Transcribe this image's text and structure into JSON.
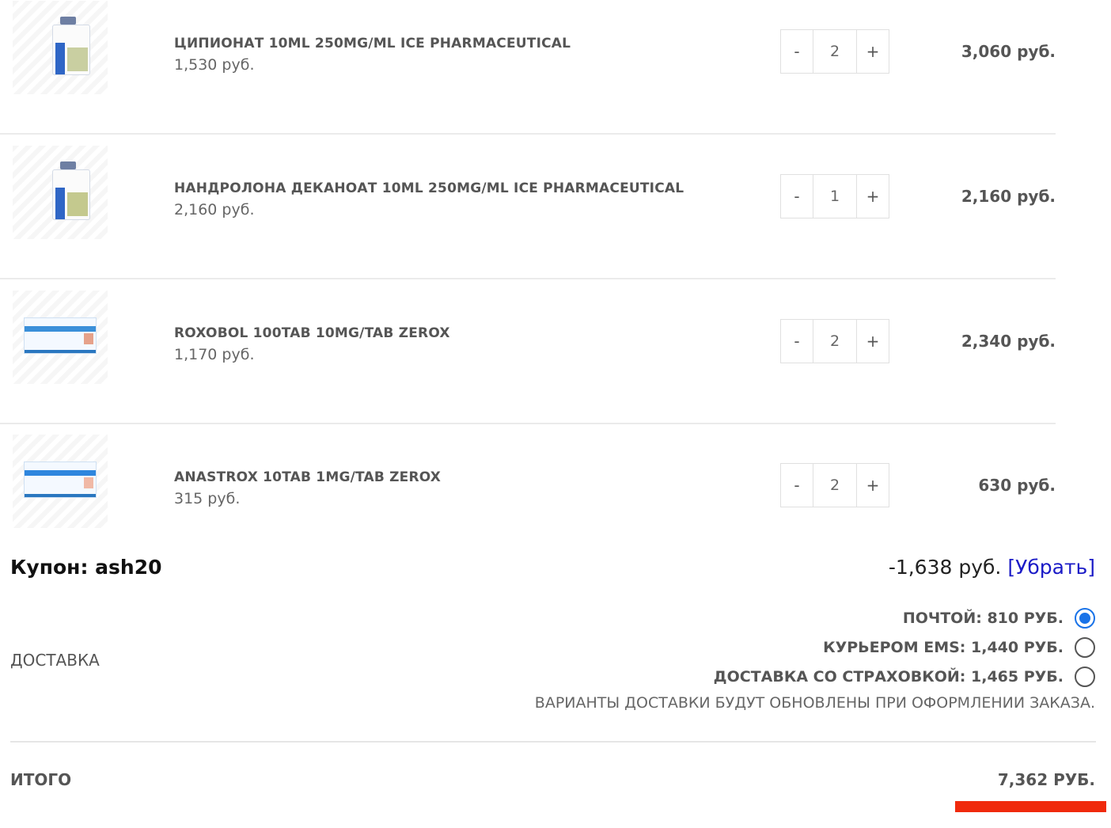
{
  "cart": {
    "items": [
      {
        "name": "ЦИПИОНАТ 10ML 250MG/ML ICE PHARMACEUTICAL",
        "unit_price": "1,530 руб.",
        "minus": "-",
        "qty": "2",
        "plus": "+",
        "total": "3,060 руб."
      },
      {
        "name": "НАНДРОЛОНА ДЕКАНОАТ 10ML 250MG/ML ICE PHARMACEUTICAL",
        "unit_price": "2,160 руб.",
        "minus": "-",
        "qty": "1",
        "plus": "+",
        "total": "2,160 руб."
      },
      {
        "name": "ROXOBOL 100TAB 10MG/TAB ZEROX",
        "unit_price": "1,170 руб.",
        "minus": "-",
        "qty": "2",
        "plus": "+",
        "total": "2,340 руб."
      },
      {
        "name": "ANASTROX 10TAB 1MG/TAB ZEROX",
        "unit_price": "315 руб.",
        "minus": "-",
        "qty": "2",
        "plus": "+",
        "total": "630 руб."
      }
    ]
  },
  "coupon": {
    "label": "Купон: ash20",
    "amount": "-1,638 руб.",
    "remove_label": "[Убрать]"
  },
  "shipping": {
    "label": "ДОСТАВКА",
    "options": [
      {
        "label": "ПОЧТОЙ: 810 РУБ.",
        "selected": true
      },
      {
        "label": "КУРЬЕРОМ EMS: 1,440 РУБ.",
        "selected": false
      },
      {
        "label": "ДОСТАВКА СО СТРАХОВКОЙ: 1,465 РУБ.",
        "selected": false
      }
    ],
    "note": "ВАРИАНТЫ ДОСТАВКИ БУДУТ ОБНОВЛЕНЫ ПРИ ОФОРМЛЕНИИ ЗАКАЗА."
  },
  "total": {
    "label": "ИТОГО",
    "value": "7,362 РУБ."
  },
  "colors": {
    "accent": "#1a73e8",
    "link": "#1b1bc7",
    "highlight": "#f02a0c"
  }
}
